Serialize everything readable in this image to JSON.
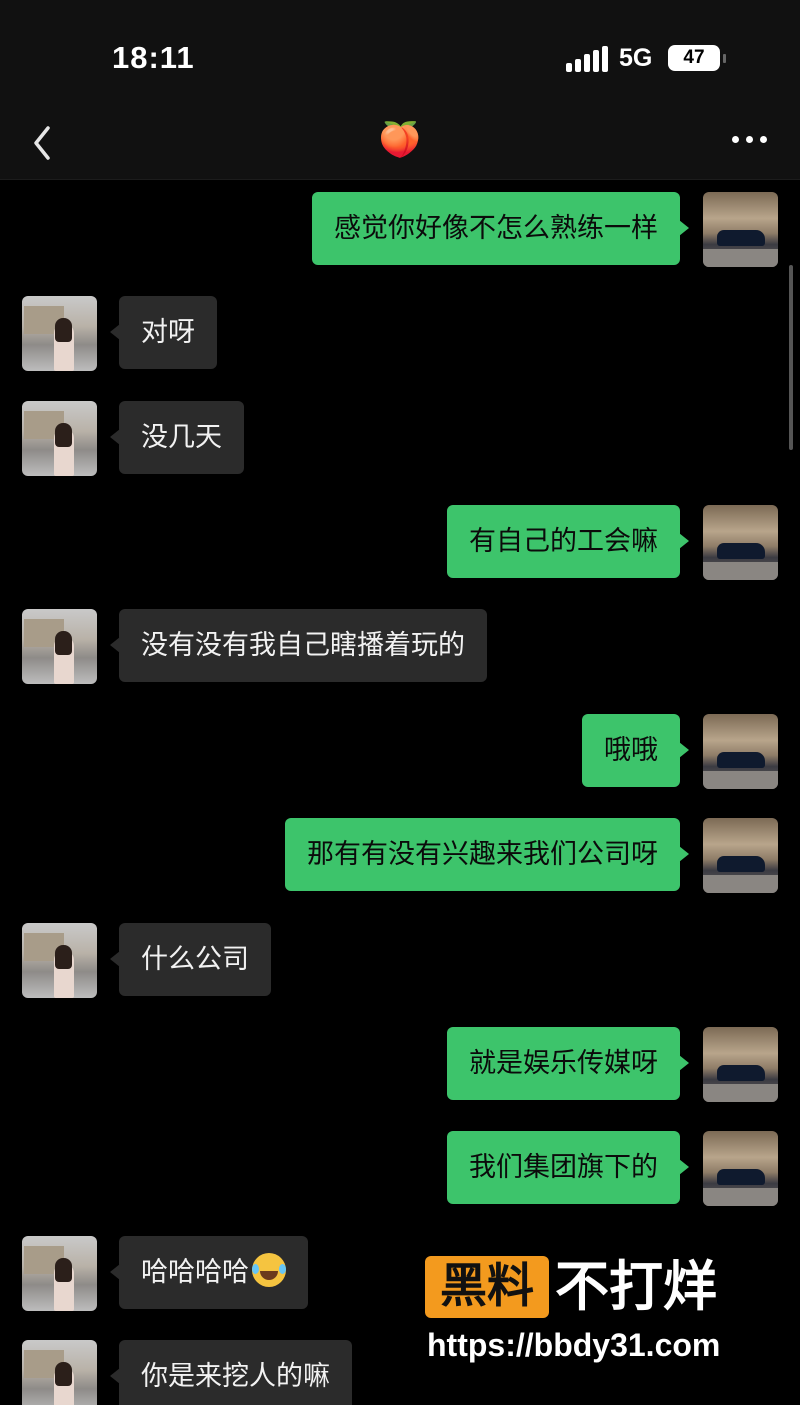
{
  "status_bar": {
    "time": "18:11",
    "network": "5G",
    "battery": "47"
  },
  "nav": {
    "title": "🍑"
  },
  "messages": [
    {
      "side": "mine",
      "text": "感觉你好像不怎么熟练一样"
    },
    {
      "side": "theirs",
      "text": "对呀"
    },
    {
      "side": "theirs",
      "text": "没几天"
    },
    {
      "side": "mine",
      "text": "有自己的工会嘛"
    },
    {
      "side": "theirs",
      "text": "没有没有我自己瞎播着玩的"
    },
    {
      "side": "mine",
      "text": "哦哦"
    },
    {
      "side": "mine",
      "text": "那有有没有兴趣来我们公司呀"
    },
    {
      "side": "theirs",
      "text": "什么公司"
    },
    {
      "side": "mine",
      "text": "就是娱乐传媒呀"
    },
    {
      "side": "mine",
      "text": "我们集团旗下的"
    },
    {
      "side": "theirs",
      "text": "哈哈哈哈",
      "emoji": "laughing-with-tears"
    },
    {
      "side": "theirs",
      "text": "你是来挖人的嘛"
    }
  ],
  "watermark": {
    "badge": "黑料",
    "tagline": "不打烊",
    "url": "https://bbdy31.com",
    "badge_color": "#f39a1e"
  },
  "colors": {
    "my_bubble": "#3dc46b",
    "their_bubble": "#2b2b2b",
    "background": "#000000"
  }
}
